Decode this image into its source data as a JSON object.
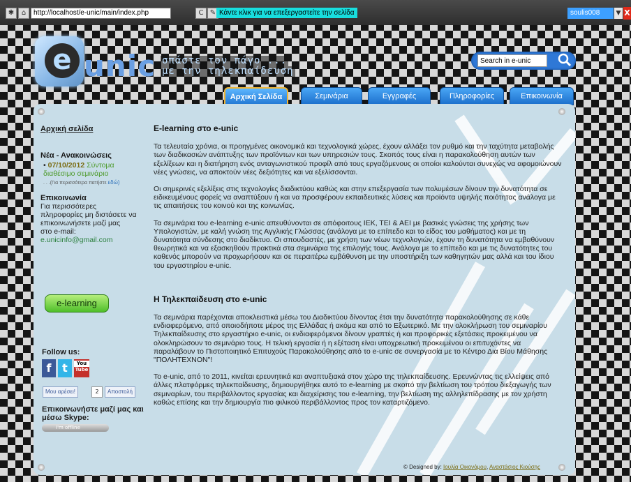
{
  "browser": {
    "url": "http://localhost/e-unic/main/index.php",
    "edit_hint": "Κάντε κλικ για να επεξεργαστείτε την σελίδα",
    "user": "soulis008",
    "close_label": "X"
  },
  "header": {
    "logo_letter": "e",
    "logo_text": "unic",
    "slogan_line1": "σπάστε τον πάγο ...",
    "slogan_line2": "με την τηλεκπαίδευση",
    "search_placeholder": "Search in e-unic"
  },
  "nav": {
    "tabs": [
      {
        "label": "Αρχική Σελίδα",
        "active": true
      },
      {
        "label": "Σεμινάρια",
        "active": false
      },
      {
        "label": "Εγγραφές",
        "active": false
      },
      {
        "label": "Πληροφορίες",
        "active": false
      },
      {
        "label": "Επικοινωνία",
        "active": false
      }
    ]
  },
  "sidebar": {
    "home_link": "Αρχική σελίδα",
    "news_heading": "Νέα - Ανακοινώσεις",
    "news_bullet": "•",
    "news_date": "07/10/2012",
    "news_text": "Σύντομα διαθέσιμο σεμινάριο",
    "news_more_prefix": ". . .(Για περισσότερα πατήστε",
    "news_more_link": "εδώ)",
    "contact_heading": "Επικοινωνία",
    "contact_text": "Για περισσότερες πληροφορίες μη διστάσετε να επικοινωνήσετε μαζί μας",
    "email_label": "στο e-mail:",
    "email": "e.unicinfo@gmail.com",
    "elearning_button": "e-learning",
    "follow_us": "Follow us:",
    "facebook_letter": "f",
    "twitter_letter": "t",
    "youtube_top": "You",
    "youtube_bottom": "Tube",
    "like_label": "Μου αρέσει!",
    "like_count": "2",
    "send_label": "Αποστολή",
    "skype_heading": "Επικοινωνήστε μαζί μας και μέσω Skype:",
    "skype_status": "I'm offline"
  },
  "main": {
    "section1_title": "E-learning στο e-unic",
    "section1_p1": "Τα τελευταία χρόνια, οι προηγμένες οικονομικά και τεχνολογικά χώρες, έχουν αλλάξει τον ρυθμό και την ταχύτητα μεταβολής των διαδικασιών ανάπτυξης των προϊόντων και των υπηρεσιών τους. Σκοπός τους είναι η παρακολούθηση αυτών των εξελίξεων και η διατήρηση ενός ανταγωνιστικού προφίλ από τους εργαζόμενους οι οποίοι καλούνται συνεχώς να αφομοιώνουν νέες γνώσεις, να αποκτούν νέες δεξιότητες και να εξελίσσονται.",
    "section1_p2": "Οι σημερινές εξελίξεις στις τεχνολογίες διαδικτύου καθώς και στην επεξεργασία των πολυμέσων δίνουν την δυνατότητα σε ειδικευμένους φορείς να αναπτύξουν ή και να προσφέρουν εκπαιδευτικές λύσεις και προϊόντα υψηλής ποιότητας ανάλογα με τις απαιτήσεις του κοινού και της κοινωνίας.",
    "section1_p3": "Τα σεμινάρια του e-learning e-unic απευθύνονται σε απόφοιτους ΙΕΚ, ΤΕΙ & ΑΕΙ με βασικές γνώσεις της χρήσης των Υπολογιστών, με καλή γνώση της Αγγλικής Γλώσσας (ανάλογα με το επίπεδο και το είδος του μαθήματος) και με τη δυνατότητα σύνδεσης στο διαδίκτυο. Οι σπουδαστές, με χρήση των νέων τεχνολογιών, έχουν τη δυνατότητα να εμβαθύνουν θεωρητικά και να εξασκηθούν πρακτικά στα σεμινάρια της επιλογής τους. Ανάλογα με το επίπεδο και με τις δυνατότητες του καθενός μπορούν να προχωρήσουν και σε περαιτέρω εμβάθυνση με την υποστήριξη των καθηγητών μας αλλά και του ίδιου του εργαστηρίου e-unic.",
    "section2_title": "Η Τηλεκπαίδευση στο e-unic",
    "section2_p1": "Τα σεμινάρια παρέχονται αποκλειστικά μέσω του Διαδικτύου δίνοντας έτσι την δυνατότητα παρακολούθησης σε κάθε ενδιαφερόμενο, από οποιοδήποτε μέρος της Ελλάδας ή ακόμα και από το Εξωτερικό. Με την ολοκλήρωση του σεμιναρίου Τηλεκπαίδευσης στο εργαστήριο e-unic, οι ενδιαφερόμενοι δίνουν γραπτές ή και προφορικές εξετάσεις προκειμένου να ολοκληρώσουν το σεμινάριο τους. Η τελική εργασία ή η εξέταση είναι υποχρεωτική προκειμένου οι επιτυχόντες να παραλάβουν το Πιστοποιητικό Επιτυχούς Παρακολούθησης από το e-unic σε συνεργασία με το Κέντρο Δια Βίου Μάθησης \"ΠΟΛΗΤΕΧΝΟΝ\"!",
    "section2_p2": "Το e-unic, από το 2011, κινείται ερευνητικά και αναπτυξιακά στον χώρο της τηλεκπαίδευσης. Ερευνώντας τις ελλείψεις από άλλες πλατφόρμες τηλεκπαίδευσης, δημιουργήθηκε αυτό το e-learning με σκοπό την βελτίωση του τρόπου διεξαγωγής των σεμιναρίων, του περιβάλλοντος εργασίας και διαχείρισης του e-learning, την βελτίωση της αλληλεπίδρασης με τον χρήστη καθώς επίσης και την δημιουργία πιο φιλικού περιβάλλοντος προς τον καταρτιζόμενο."
  },
  "footer": {
    "prefix": "© Designed by:",
    "author1": "Ιουλία Οικονόμου",
    "separator": ",",
    "author2": "Αναστάσιος Κιούσης"
  },
  "colors": {
    "panel": "#c8dde8",
    "tab_blue": "#1b6fcc",
    "active_border": "#f2b634",
    "news_green": "#4d9a2a",
    "button_green": "#4fbf2a"
  }
}
